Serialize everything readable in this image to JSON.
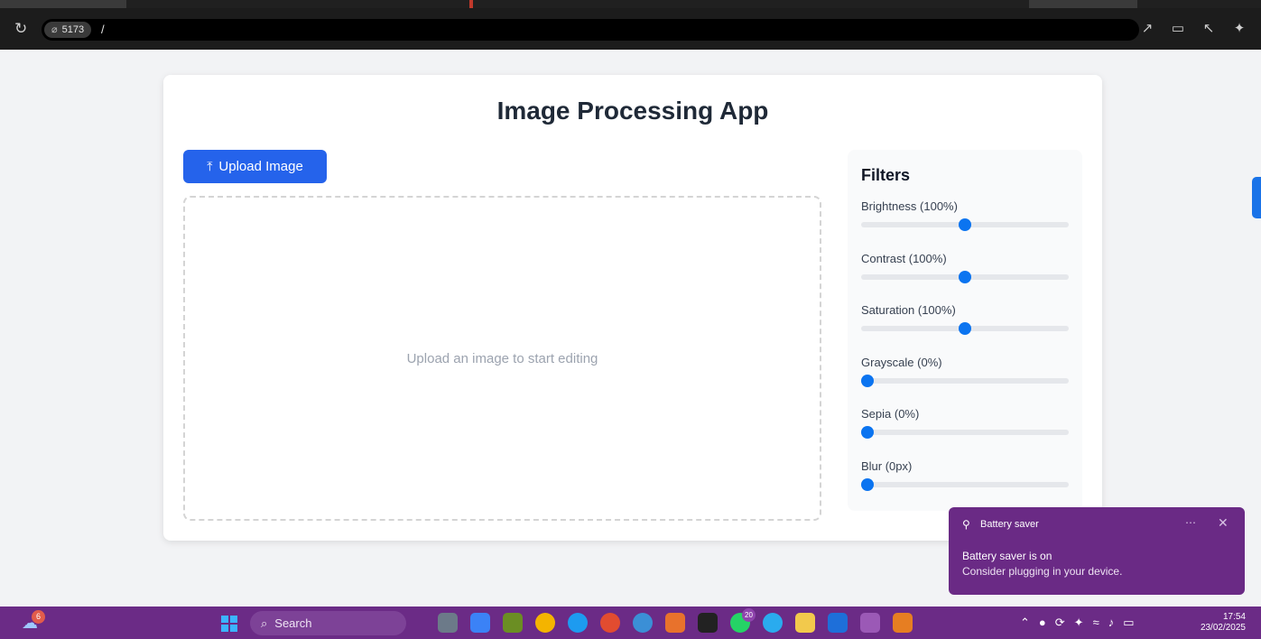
{
  "browser": {
    "port": "5173",
    "path": "/"
  },
  "app": {
    "title": "Image Processing App",
    "upload_label": "Upload Image",
    "dropzone_text": "Upload an image to start editing"
  },
  "filters": {
    "heading": "Filters",
    "items": [
      {
        "label": "Brightness (100%)",
        "value": 100,
        "min": 0,
        "max": 200
      },
      {
        "label": "Contrast (100%)",
        "value": 100,
        "min": 0,
        "max": 200
      },
      {
        "label": "Saturation (100%)",
        "value": 100,
        "min": 0,
        "max": 200
      },
      {
        "label": "Grayscale (0%)",
        "value": 0,
        "min": 0,
        "max": 100
      },
      {
        "label": "Sepia (0%)",
        "value": 0,
        "min": 0,
        "max": 100
      },
      {
        "label": "Blur (0px)",
        "value": 0,
        "min": 0,
        "max": 10
      }
    ]
  },
  "notification": {
    "app": "Battery saver",
    "title": "Battery saver is on",
    "body": "Consider plugging in your device."
  },
  "taskbar": {
    "weather_badge": "6",
    "search_label": "Search",
    "whatsapp_badge": "20",
    "time": "17:54",
    "date": "23/02/2025"
  },
  "colors": {
    "accent": "#2563eb",
    "slider_thumb": "#0b74f0",
    "taskbar": "#6b2b86",
    "toast": "#6a2a85"
  }
}
